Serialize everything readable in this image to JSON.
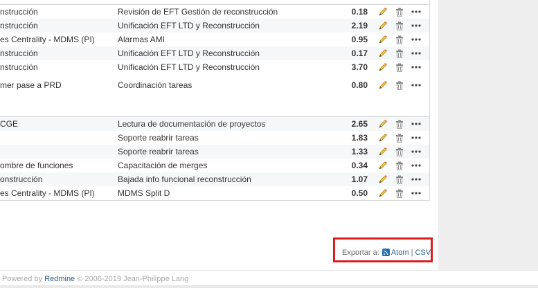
{
  "rows": [
    {
      "issue": "nstrucción",
      "comment": "Revisión de EFT Gestión de reconstrucción",
      "hours": "0.18"
    },
    {
      "issue": "nstrucción",
      "comment": "Unificación EFT LTD y Reconstrucción",
      "hours": "2.19"
    },
    {
      "issue": "es Centrality - MDMS (PI)",
      "comment": "Alarmas AMI",
      "hours": "0.95"
    },
    {
      "issue": "nstrucción",
      "comment": "Unificación EFT LTD y Reconstrucción",
      "hours": "0.17"
    },
    {
      "issue": "nstrucción",
      "comment": "Unificación EFT LTD y Reconstrucción",
      "hours": "3.70"
    },
    {
      "issue": "mer pase a PRD",
      "comment": "Coordinación tareas",
      "hours": "0.80"
    },
    {
      "issue": "CGE",
      "comment": "Lectura de documentación de proyectos",
      "hours": "2.65"
    },
    {
      "issue": "",
      "comment": "Soporte reabrir tareas",
      "hours": "1.83"
    },
    {
      "issue": "",
      "comment": "Soporte reabrir tareas",
      "hours": "1.33"
    },
    {
      "issue": "ombre de funciones",
      "comment": "Capacitación de merges",
      "hours": "0.34"
    },
    {
      "issue": "onstrucción",
      "comment": "Bajada info funcional reconstrucción",
      "hours": "1.07"
    },
    {
      "issue": "es Centrality - MDMS (PI)",
      "comment": "MDMS Split D",
      "hours": "0.50"
    }
  ],
  "export": {
    "label": "Exportar a:",
    "atom": "Atom",
    "separator": "|",
    "csv": "CSV"
  },
  "footer": {
    "powered_by": "Powered by",
    "redmine": "Redmine",
    "copyright": "© 2006-2019 Jean-Philippe Lang"
  },
  "colors": {
    "highlight_border": "#d81e1e",
    "link": "#2a5a8a",
    "row_alt": "#f6f7f8"
  }
}
